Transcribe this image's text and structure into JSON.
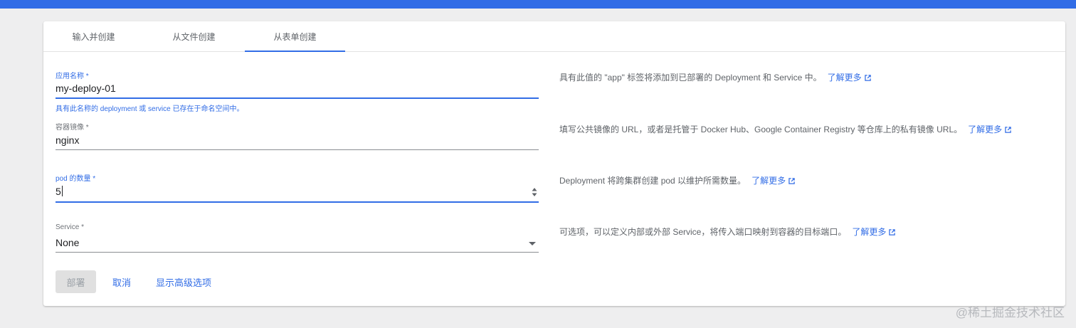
{
  "tabs": [
    {
      "label": "输入并创建"
    },
    {
      "label": "从文件创建"
    },
    {
      "label": "从表单创建",
      "active": true
    }
  ],
  "form": {
    "app_name": {
      "label": "应用名称 *",
      "value": "my-deploy-01",
      "hint": "具有此名称的 deployment 或 service 已存在于命名空间中。"
    },
    "image": {
      "label": "容器镜像 *",
      "value": "nginx"
    },
    "pods": {
      "label": "pod 的数量 *",
      "value": "5"
    },
    "service": {
      "label": "Service *",
      "value": "None"
    }
  },
  "help": {
    "app_name": "具有此值的 \"app\" 标签将添加到已部署的 Deployment 和 Service 中。",
    "image": "填写公共镜像的 URL，或者是托管于 Docker Hub、Google Container Registry 等仓库上的私有镜像 URL。",
    "pods": "Deployment 将跨集群创建 pod 以维护所需数量。",
    "service": "可选项，可以定义内部或外部 Service，将传入端口映射到容器的目标端口。",
    "learn_more": "了解更多"
  },
  "actions": {
    "deploy": "部署",
    "cancel": "取消",
    "advanced": "显示高级选项"
  },
  "watermark": "@稀土掘金技术社区",
  "colors": {
    "accent": "#326de6",
    "topbar": "#326de6",
    "background": "#eeeeef"
  }
}
